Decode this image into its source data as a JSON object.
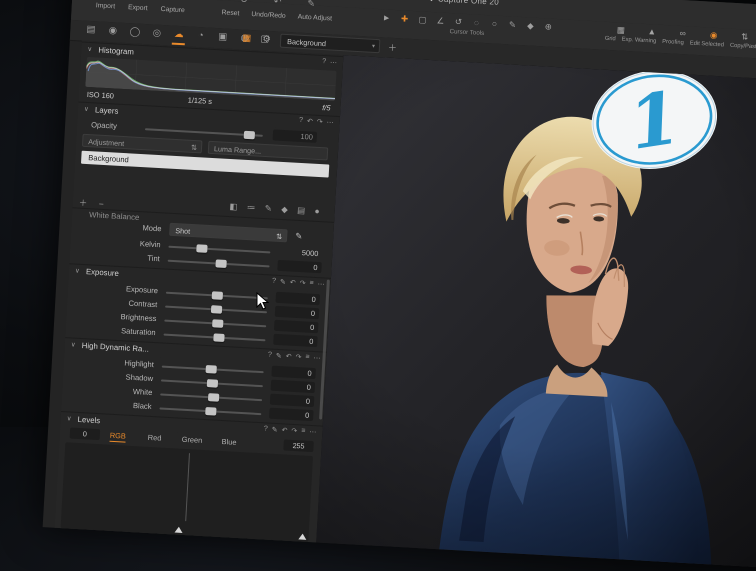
{
  "titlebar": {
    "title": "Capture One 20"
  },
  "toolbar": {
    "left_labels": [
      "Import",
      "Export",
      "Capture"
    ],
    "mid_labels": [
      "Reset",
      "Undo/Redo",
      "Auto Adjust"
    ],
    "cursor_tools_caption": "Cursor Tools",
    "right_items": [
      {
        "label": "Grid"
      },
      {
        "label": "Exp. Warning"
      },
      {
        "label": "Proofing"
      },
      {
        "label": "Edit Selected"
      },
      {
        "label": "Copy/Paste"
      }
    ]
  },
  "viewer_bar": {
    "layer_tab": "Background"
  },
  "panel": {
    "histogram": {
      "title": "Histogram",
      "iso": "ISO 160",
      "shutter": "1/125 s",
      "aperture": "f/5"
    },
    "layers": {
      "title": "Layers",
      "opacity_label": "Opacity",
      "opacity_value": "100",
      "adjustment_label": "Adjustment",
      "luma_range_label": "Luma Range...",
      "background_layer": "Background"
    },
    "white_balance": {
      "title": "White Balance",
      "mode_label": "Mode",
      "mode_value": "Shot",
      "kelvin_label": "Kelvin",
      "kelvin_value": "5000",
      "tint_label": "Tint",
      "tint_value": "0"
    },
    "exposure": {
      "title": "Exposure",
      "sliders": [
        {
          "label": "Exposure",
          "value": "0"
        },
        {
          "label": "Contrast",
          "value": "0"
        },
        {
          "label": "Brightness",
          "value": "0"
        },
        {
          "label": "Saturation",
          "value": "0"
        }
      ]
    },
    "hdr": {
      "title": "High Dynamic Ra...",
      "sliders": [
        {
          "label": "Highlight",
          "value": "0"
        },
        {
          "label": "Shadow",
          "value": "0"
        },
        {
          "label": "White",
          "value": "0"
        },
        {
          "label": "Black",
          "value": "0"
        }
      ]
    },
    "levels": {
      "title": "Levels",
      "min": "0",
      "max": "255",
      "channels": [
        "RGB",
        "Red",
        "Green",
        "Blue"
      ],
      "selected_channel": "RGB"
    }
  },
  "badge": {
    "numeral": "1"
  },
  "colors": {
    "accent_orange": "#e98a2b",
    "badge_blue": "#2a9ad0",
    "selected_layer_bg": "#dcdcdc",
    "panel_bg": "#262626",
    "toolbar_bg": "#2d2d2d"
  },
  "icons": {
    "logo": "❖",
    "chevron": "∨",
    "caret": "▾",
    "help": "?",
    "edit": "✎",
    "undo": "↶",
    "redo": "↷",
    "menu": "≡",
    "more": "⋯",
    "plus": "＋",
    "minus": "−",
    "swap": "⇅",
    "grid": "▦",
    "warning": "▲",
    "proofing": "∞",
    "edit_selected": "◉",
    "folder": "▤",
    "camera": "◉",
    "styles": "◯",
    "color": "◎",
    "exposure_tab": "☁",
    "curve": "◔",
    "details": "▣",
    "lens": "◍",
    "gear": "⚙",
    "misc": "∗",
    "pointer": "►",
    "hand": "✚",
    "crop": "▢",
    "straighten": "∠",
    "rotate": "↺",
    "spot": "◌",
    "draw": "✎",
    "shape": "○",
    "pick": "◆",
    "zoom": "⊕",
    "image": "◧",
    "list": "≔",
    "brush": "✎",
    "eraser": "◆",
    "gradient": "▤",
    "radial": "●",
    "eyedropper": "✎"
  }
}
